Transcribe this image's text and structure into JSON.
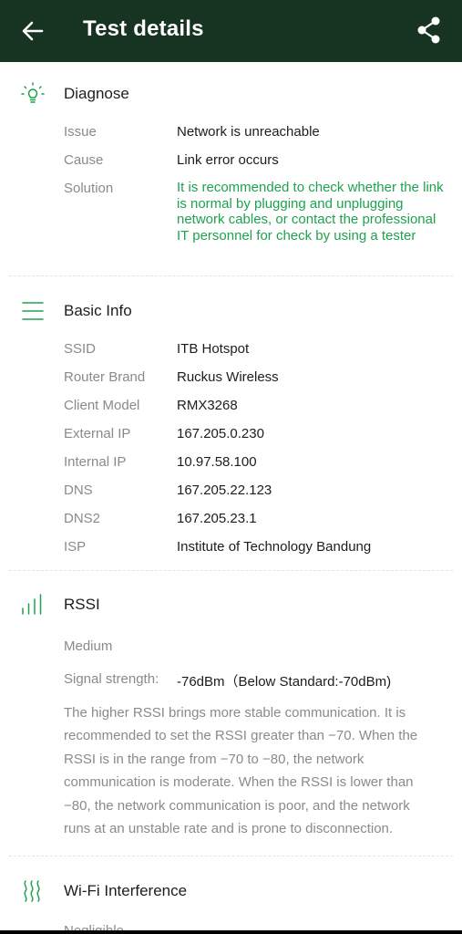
{
  "appbar": {
    "title": "Test details",
    "bg_color": "#173322",
    "back_icon": "arrow-left-icon",
    "share_icon": "share-icon"
  },
  "accent_color": "#1fa24e",
  "diagnose": {
    "title": "Diagnose",
    "icon": "lightbulb-icon",
    "rows": [
      {
        "label": "Issue",
        "value": "Network is unreachable"
      },
      {
        "label": "Cause",
        "value": "Link error occurs"
      },
      {
        "label": "Solution",
        "value": "It is recommended to check whether the link is normal by plugging and unplugging network cables, or contact the professional IT personnel for check by using a tester"
      }
    ]
  },
  "basic_info": {
    "title": "Basic Info",
    "icon": "menu-lines-icon",
    "rows": [
      {
        "label": "SSID",
        "value": "ITB Hotspot"
      },
      {
        "label": "Router Brand",
        "value": "Ruckus Wireless"
      },
      {
        "label": "Client Model",
        "value": "RMX3268"
      },
      {
        "label": "External IP",
        "value": "167.205.0.230"
      },
      {
        "label": "Internal IP",
        "value": "10.97.58.100"
      },
      {
        "label": "DNS",
        "value": "167.205.22.123"
      },
      {
        "label": "DNS2",
        "value": "167.205.23.1"
      },
      {
        "label": "ISP",
        "value": "Institute of Technology Bandung"
      }
    ]
  },
  "rssi": {
    "title": "RSSI",
    "icon": "signal-bars-icon",
    "level": "Medium",
    "signal_label": "Signal strength:",
    "signal_value": "-76dBm（Below Standard:-70dBm)",
    "description": "The higher RSSI brings more stable communication. It is recommended to set the RSSI greater than −70. When the RSSI is in the range from −70 to −80, the network communication is moderate. When the RSSI is lower than −80, the network communication is poor, and the network runs at an unstable rate and is prone to disconnection."
  },
  "interference": {
    "title": "Wi-Fi Interference",
    "icon": "wave-lines-icon",
    "level": "Negligible"
  }
}
